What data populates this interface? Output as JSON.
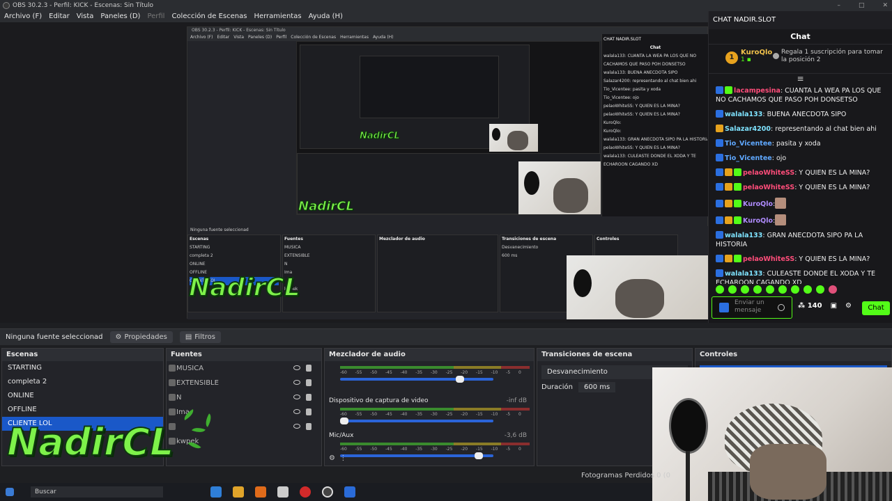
{
  "window": {
    "title": "OBS 30.2.3 - Perfil: KICK - Escenas: Sin Título"
  },
  "menu": [
    {
      "label": "Archivo (F)",
      "dim": false
    },
    {
      "label": "Editar",
      "dim": false
    },
    {
      "label": "Vista",
      "dim": false
    },
    {
      "label": "Paneles (D)",
      "dim": false
    },
    {
      "label": "Perfil",
      "dim": true
    },
    {
      "label": "Colección de Escenas",
      "dim": false
    },
    {
      "label": "Herramientas",
      "dim": false
    },
    {
      "label": "Ayuda (H)",
      "dim": false
    }
  ],
  "logo": {
    "text": "NadirCL"
  },
  "chat": {
    "window_title": "CHAT NADIR.SLOT",
    "header": "Chat",
    "banner": {
      "user": "KuroQlo",
      "rank": "1",
      "count": "1",
      "text": "Regala 1 suscripción para tomar la posición 2"
    },
    "messages": [
      {
        "user": "lacampesina",
        "color": "#ff4d7a",
        "badges": [
          "kick",
          "gr"
        ],
        "text": ": CUANTA LA WEA PA LOS QUE NO CACHAMOS QUE PASO POH DONSETSO"
      },
      {
        "user": "walala133",
        "color": "#7fe3ff",
        "badges": [
          "kick"
        ],
        "text": ": BUENA ANECDOTA SIPO"
      },
      {
        "user": "Salazar4200",
        "color": "#7fe3ff",
        "badges": [
          "crown"
        ],
        "text": ": representando al chat bien ahi"
      },
      {
        "user": "Tio_Vicentee",
        "color": "#5fa8ff",
        "badges": [
          "kick"
        ],
        "text": ": pasita y xoda"
      },
      {
        "user": "Tio_Vicentee",
        "color": "#5fa8ff",
        "badges": [
          "kick"
        ],
        "text": ": ojo"
      },
      {
        "user": "pelaoWhiteSS",
        "color": "#ff4d7a",
        "badges": [
          "kick",
          "crown",
          "gr"
        ],
        "text": ": Y QUIEN ES LA MINA?"
      },
      {
        "user": "pelaoWhiteSS",
        "color": "#ff4d7a",
        "badges": [
          "kick",
          "crown",
          "gr"
        ],
        "text": ": Y QUIEN ES LA MINA?"
      },
      {
        "user": "KuroQlo",
        "color": "#b08cff",
        "badges": [
          "kick",
          "crown",
          "gr"
        ],
        "text": ":",
        "avatar": true
      },
      {
        "user": "KuroQlo",
        "color": "#b08cff",
        "badges": [
          "kick",
          "crown",
          "gr"
        ],
        "text": ":",
        "avatar": true
      },
      {
        "user": "walala133",
        "color": "#7fe3ff",
        "badges": [
          "kick"
        ],
        "text": ": GRAN ANECDOTA SIPO PA LA HISTORIA"
      },
      {
        "user": "pelaoWhiteSS",
        "color": "#ff4d7a",
        "badges": [
          "kick",
          "crown",
          "gr"
        ],
        "text": ": Y QUIEN ES LA MINA?"
      },
      {
        "user": "walala133",
        "color": "#7fe3ff",
        "badges": [
          "kick"
        ],
        "text": ": CULEASTE DONDE EL XODA Y TE ECHAROON CAGANDO XD"
      }
    ],
    "input_placeholder": "Enviar un mensaje",
    "points": "140",
    "send_label": "Chat"
  },
  "selbar": {
    "text": "Ninguna fuente seleccionad",
    "properties": "Propiedades",
    "filters": "Filtros"
  },
  "scenes": {
    "title": "Escenas",
    "items": [
      "STARTING",
      "completa 2",
      "ONLINE",
      "OFFLINE",
      "CLIENTE LOL"
    ],
    "selected": 4
  },
  "sources": {
    "title": "Fuentes",
    "items": [
      "MUSICA",
      "EXTENSIBLE",
      "N",
      "Ima",
      "",
      "kwpek"
    ]
  },
  "mixer": {
    "title": "Mezclador de audio",
    "ticks": [
      "-60",
      "-55",
      "-50",
      "-45",
      "-40",
      "-35",
      "-30",
      "-25",
      "-20",
      "-15",
      "-10",
      "-5",
      "0"
    ],
    "channels": [
      {
        "name": "",
        "value": "",
        "level": 0.8
      },
      {
        "name": "Dispositivo de captura de video",
        "value": "-inf dB",
        "level": 0.0
      },
      {
        "name": "Mic/Aux",
        "value": "-3,6 dB",
        "level": 0.93
      }
    ]
  },
  "transitions": {
    "title": "Transiciones de escena",
    "type": "Desvanecimiento",
    "duration_label": "Duración",
    "duration_value": "600 ms"
  },
  "controls": {
    "title": "Controles"
  },
  "status": {
    "dropped": "Fotogramas Perdidos 0 (0"
  },
  "taskbar": {
    "search": "Buscar"
  },
  "mini_chat_lines": [
    "walala133: CUANTA LA WEA PA LOS QUE NO",
    "CACHAMOS QUE PASO POH DONSETSO",
    "walala133: BUENA ANECDOTA SIPO",
    "Salazar4200: representando al chat bien ahi",
    "Tio_Vicentee: pasita y xoda",
    "Tio_Vicentee: ojo",
    "pelaoWhiteSS: Y QUIEN ES LA MINA?",
    "pelaoWhiteSS: Y QUIEN ES LA MINA?",
    "KuroQlo:",
    "KuroQlo:",
    "walala133: GRAN ANECDOTA SIPO PA LA HISTORIA",
    "pelaoWhiteSS: Y QUIEN ES LA MINA?",
    "walala133: CULEASTE DONDE EL XODA Y TE",
    "ECHAROON CAGANDO XD"
  ],
  "mini_docks": [
    "Escenas",
    "Fuentes",
    "Mezclador de audio",
    "Transiciones de escena",
    "Controles"
  ]
}
